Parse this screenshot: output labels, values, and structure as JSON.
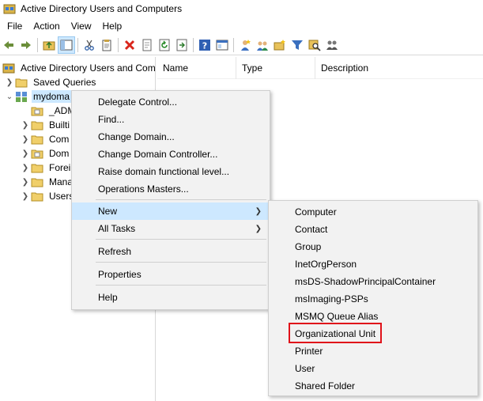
{
  "window": {
    "title": "Active Directory Users and Computers"
  },
  "menubar": [
    "File",
    "Action",
    "View",
    "Help"
  ],
  "toolbar": {
    "icons": [
      "back-icon",
      "forward-icon",
      "up-folder-icon",
      "show-hide-tree-icon",
      "cut-icon",
      "copy-icon",
      "delete-icon",
      "properties-icon",
      "refresh-icon",
      "export-list-icon",
      "help-icon",
      "console-tree-icon",
      "new-user-icon",
      "new-group-icon",
      "new-ou-icon",
      "filter-icon",
      "find-icon",
      "add-to-group-icon"
    ]
  },
  "tree": {
    "root": "Active Directory Users and Com",
    "saved_queries": "Saved Queries",
    "domain": "mydoma",
    "children": [
      "_ADM",
      "Builti",
      "Com",
      "Dom",
      "Forei",
      "Mana",
      "Users"
    ]
  },
  "list": {
    "columns": [
      "Name",
      "Type",
      "Description"
    ]
  },
  "context_menu": {
    "items": [
      "Delegate Control...",
      "Find...",
      "Change Domain...",
      "Change Domain Controller...",
      "Raise domain functional level...",
      "Operations Masters...",
      "New",
      "All Tasks",
      "Refresh",
      "Properties",
      "Help"
    ],
    "highlighted": "New"
  },
  "submenu": {
    "items": [
      "Computer",
      "Contact",
      "Group",
      "InetOrgPerson",
      "msDS-ShadowPrincipalContainer",
      "msImaging-PSPs",
      "MSMQ Queue Alias",
      "Organizational Unit",
      "Printer",
      "User",
      "Shared Folder"
    ],
    "marked": "Organizational Unit",
    "mark_color": "#e0121a"
  },
  "colors": {
    "selection": "#cce8ff",
    "menu_bg": "#f2f2f2",
    "hover": "#cde8ff"
  }
}
